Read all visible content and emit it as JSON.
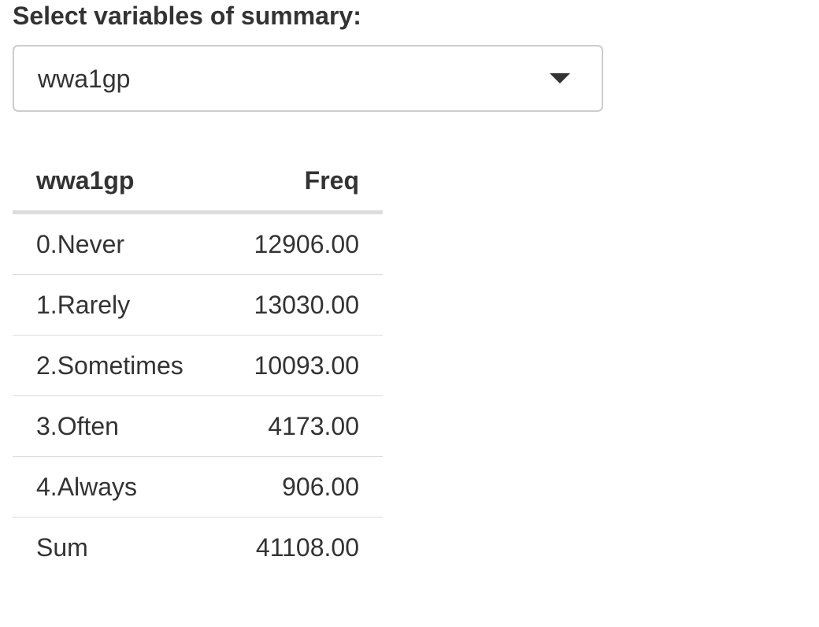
{
  "field": {
    "label": "Select variables of summary:",
    "selected_value": "wwa1gp"
  },
  "table": {
    "headers": [
      "wwa1gp",
      "Freq"
    ],
    "rows": [
      [
        "0.Never",
        "12906.00"
      ],
      [
        "1.Rarely",
        "13030.00"
      ],
      [
        "2.Sometimes",
        "10093.00"
      ],
      [
        "3.Often",
        "4173.00"
      ],
      [
        "4.Always",
        "906.00"
      ],
      [
        "Sum",
        "41108.00"
      ]
    ]
  },
  "icons": {
    "dropdown": "caret-down-icon"
  }
}
